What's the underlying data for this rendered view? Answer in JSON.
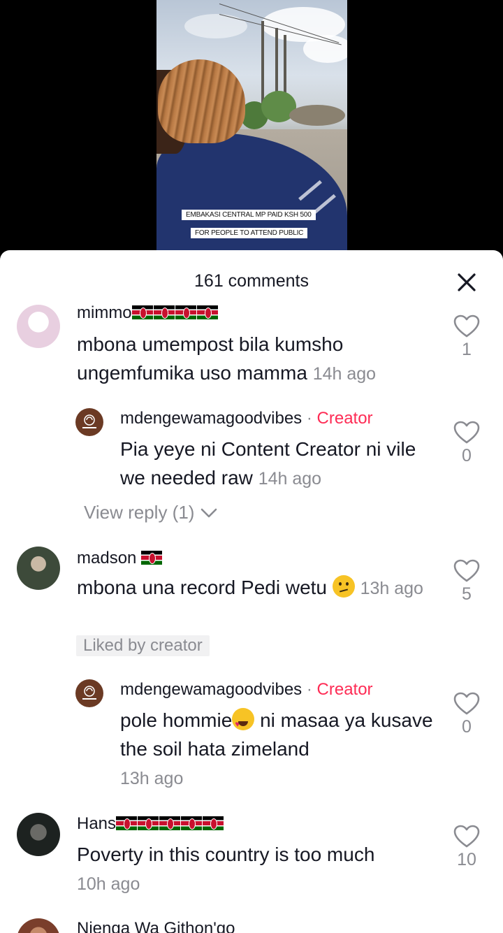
{
  "video": {
    "captions": [
      "EMBAKASI CENTRAL MP PAID KSH 500",
      "FOR PEOPLE TO ATTEND PUBLIC"
    ]
  },
  "sheet": {
    "title": "161 comments",
    "close_icon": "close-icon"
  },
  "comments": [
    {
      "username": "mimmo",
      "flags": 4,
      "text": "mbona umempost bila kumsho ungemfumika uso mamma",
      "time": "14h ago",
      "likes": "1",
      "avatar_color": "#e9d6e4"
    },
    {
      "username": "mdengewamagoodvibes",
      "separator": "·",
      "creator_label": "Creator",
      "text": "Pia yeye ni Content Creator ni vile we needed raw",
      "time": "14h ago",
      "likes": "0"
    },
    {
      "view_reply": "View reply (1)"
    },
    {
      "username": "madson",
      "flags": 1,
      "text": "mbona una record Pedi wetu",
      "emoji": "confused-face",
      "time": "13h ago",
      "likes": "5",
      "liked_by": "Liked by creator"
    },
    {
      "username": "mdengewamagoodvibes",
      "separator": "·",
      "creator_label": "Creator",
      "text_a": "pole hommie",
      "emoji": "heart-eyes-face",
      "text_b": " ni masaa ya kusave the soil hata zimeland",
      "time": "13h ago",
      "likes": "0"
    },
    {
      "username": "Hans",
      "flags": 5,
      "text": "Poverty in this country is too much",
      "time": "10h ago",
      "likes": "10"
    },
    {
      "username": "Njenga Wa Githon'go"
    }
  ],
  "colors": {
    "creator": "#fe2c55",
    "secondary_text": "#8a8b91",
    "primary_text": "#161823"
  }
}
